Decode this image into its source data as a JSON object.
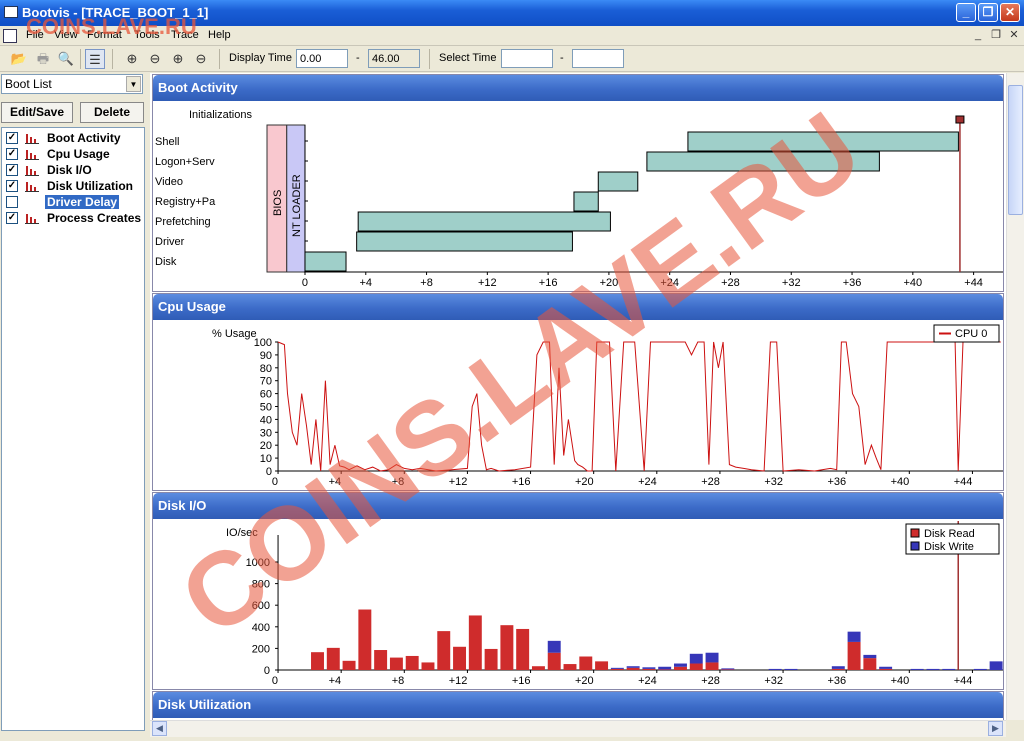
{
  "window": {
    "title": "Bootvis - [TRACE_BOOT_1_1]",
    "minimize": "_",
    "maximize": "❐",
    "close": "✕"
  },
  "menu": {
    "items": [
      "File",
      "View",
      "Format",
      "Tools",
      "Trace",
      "Help"
    ],
    "mdi_min": "_",
    "mdi_restore": "❐",
    "mdi_close": "✕"
  },
  "toolbar": {
    "display_time_label": "Display Time",
    "display_time_from": "0.00",
    "display_time_sep": "-",
    "display_time_to": "46.00",
    "select_time_label": "Select Time",
    "select_time_from": "",
    "select_time_sep": "-",
    "select_time_to": ""
  },
  "left": {
    "combo_value": "Boot List",
    "edit_save": "Edit/Save",
    "delete": "Delete",
    "items": [
      {
        "label": "Boot Activity",
        "checked": true,
        "selected": false
      },
      {
        "label": "Cpu Usage",
        "checked": true,
        "selected": false
      },
      {
        "label": "Disk I/O",
        "checked": true,
        "selected": false
      },
      {
        "label": "Disk Utilization",
        "checked": true,
        "selected": false
      },
      {
        "label": "Driver Delay",
        "checked": false,
        "selected": true
      },
      {
        "label": "Process Creates",
        "checked": true,
        "selected": false
      }
    ]
  },
  "check_mark": "✓",
  "panels": {
    "boot_activity": "Boot Activity",
    "cpu_usage": "Cpu Usage",
    "disk_io": "Disk I/O",
    "disk_utilization": "Disk Utilization"
  },
  "watermark": {
    "small": "COINS.LAVE.RU",
    "big": "COINS.LAVE.RU",
    "color": "#e8553a"
  },
  "colors": {
    "bar_fill": "#9fcfc9",
    "bios": "#f9c8cf",
    "ntloader": "#c9c8f6",
    "cpu_line": "#cc1111",
    "disk_read": "#cf2c2c",
    "disk_write": "#3636b8",
    "marker": "#a03030"
  },
  "chart_data": [
    {
      "type": "bar",
      "name_ref": "boot_activity",
      "top_label": "Initializations",
      "rows": [
        "Shell",
        "Logon+Serv",
        "Video",
        "Registry+Pa",
        "Prefetching",
        "Driver",
        "Disk"
      ],
      "phase_labels": [
        "BIOS",
        "NT LOADER"
      ],
      "x_ticks": [
        "0",
        "+4",
        "+8",
        "+12",
        "+16",
        "+20",
        "+24",
        "+28",
        "+32",
        "+36",
        "+40",
        "+44"
      ],
      "xlim": [
        -2.5,
        46.0
      ],
      "phases": [
        {
          "label": "BIOS",
          "start": -2.5,
          "end": -1.2
        },
        {
          "label": "NT LOADER",
          "start": -1.2,
          "end": 0.0
        }
      ],
      "segments": [
        {
          "row": "Shell",
          "start": 25.2,
          "end": 43.0
        },
        {
          "row": "Logon+Serv",
          "start": 22.5,
          "end": 37.8
        },
        {
          "row": "Video",
          "start": 19.3,
          "end": 21.9
        },
        {
          "row": "Registry+Pa",
          "start": 17.7,
          "end": 19.3
        },
        {
          "row": "Prefetching",
          "start": 3.5,
          "end": 20.1
        },
        {
          "row": "Driver",
          "start": 3.4,
          "end": 17.6
        },
        {
          "row": "Disk",
          "start": 0.0,
          "end": 2.7
        }
      ],
      "marker_time": 43.1
    },
    {
      "type": "line",
      "name_ref": "cpu_usage",
      "ylabel": "% Usage",
      "ylim": [
        0,
        100
      ],
      "y_ticks": [
        "0",
        "10",
        "20",
        "30",
        "40",
        "50",
        "60",
        "70",
        "80",
        "90",
        "100"
      ],
      "x_ticks": [
        "0",
        "+4",
        "+8",
        "+12",
        "+16",
        "+20",
        "+24",
        "+28",
        "+32",
        "+36",
        "+40",
        "+44"
      ],
      "xlim": [
        -0.7,
        46.0
      ],
      "series": [
        {
          "name": "CPU 0",
          "color": "#cc1111",
          "x": [
            0.0,
            0.4,
            0.6,
            0.9,
            1.2,
            1.5,
            1.8,
            2.1,
            2.4,
            2.7,
            3.0,
            3.3,
            3.6,
            3.9,
            4.2,
            4.5,
            5.0,
            5.5,
            6.0,
            6.5,
            7.0,
            7.5,
            8.0,
            8.5,
            9.0,
            10.0,
            11.0,
            12.0,
            12.3,
            12.6,
            12.9,
            13.2,
            13.5,
            14.0,
            15.0,
            16.0,
            16.4,
            16.8,
            17.2,
            17.5,
            17.8,
            18.1,
            18.4,
            18.8,
            19.0,
            19.3,
            19.6,
            19.9,
            20.2,
            20.6,
            21.0,
            21.4,
            21.9,
            22.2,
            22.6,
            23.2,
            23.6,
            24.0,
            24.5,
            25.0,
            25.4,
            25.8,
            26.2,
            26.6,
            27.0,
            27.3,
            27.6,
            27.9,
            28.2,
            28.6,
            29.0,
            29.5,
            30.0,
            30.8,
            31.2,
            31.6,
            32.0,
            33.0,
            34.0,
            35.0,
            35.4,
            35.7,
            36.0,
            36.4,
            36.8,
            37.2,
            37.6,
            37.9,
            38.2,
            38.6,
            39.0,
            40.0,
            41.0,
            42.0,
            42.6,
            42.9,
            43.1,
            43.4,
            44.0,
            45.0,
            45.8
          ],
          "values": [
            100,
            98,
            60,
            30,
            20,
            60,
            35,
            5,
            40,
            0,
            70,
            5,
            20,
            4,
            3,
            1,
            4,
            1,
            3,
            0,
            1,
            5,
            2,
            1,
            2,
            0,
            1,
            2,
            50,
            60,
            20,
            1,
            2,
            0,
            1,
            3,
            90,
            100,
            100,
            5,
            80,
            12,
            40,
            8,
            5,
            3,
            0,
            0,
            100,
            100,
            100,
            0,
            100,
            100,
            100,
            0,
            100,
            100,
            100,
            100,
            100,
            100,
            90,
            100,
            100,
            5,
            100,
            80,
            100,
            5,
            3,
            2,
            1,
            0,
            100,
            100,
            0,
            1,
            0,
            2,
            1,
            100,
            100,
            60,
            50,
            5,
            20,
            10,
            1,
            100,
            100,
            100,
            100,
            100,
            100,
            100,
            0,
            100,
            100,
            100,
            100
          ]
        }
      ],
      "legend": "top-right"
    },
    {
      "type": "bar",
      "name_ref": "disk_io",
      "ylabel": "IO/sec",
      "y_ticks": [
        "0",
        "200",
        "400",
        "600",
        "800",
        "1000"
      ],
      "ylim": [
        0,
        1250
      ],
      "x_ticks": [
        "0",
        "+4",
        "+8",
        "+12",
        "+16",
        "+20",
        "+24",
        "+28",
        "+32",
        "+36",
        "+40",
        "+44"
      ],
      "xlim": [
        -0.7,
        46.0
      ],
      "stacked": true,
      "x": [
        2.5,
        3.5,
        4.5,
        5.5,
        6.5,
        7.5,
        8.5,
        9.5,
        10.5,
        11.5,
        12.5,
        13.5,
        14.5,
        15.5,
        16.5,
        17.5,
        18.5,
        19.5,
        20.5,
        21.5,
        22.5,
        23.5,
        24.5,
        25.5,
        26.5,
        27.5,
        28.5,
        31.5,
        32.5,
        35.5,
        36.5,
        37.5,
        38.5,
        40.5,
        41.5,
        42.5,
        44.5,
        45.5
      ],
      "series": [
        {
          "name": "Disk Read",
          "color": "#cf2c2c",
          "values": [
            165,
            205,
            85,
            560,
            185,
            115,
            130,
            70,
            360,
            215,
            505,
            195,
            415,
            380,
            35,
            160,
            55,
            125,
            80,
            10,
            20,
            10,
            5,
            30,
            60,
            70,
            5,
            0,
            0,
            10,
            260,
            110,
            10,
            0,
            0,
            0,
            0,
            0
          ]
        },
        {
          "name": "Disk Write",
          "color": "#3636b8",
          "values": [
            0,
            0,
            0,
            0,
            0,
            0,
            0,
            0,
            0,
            0,
            0,
            0,
            0,
            0,
            0,
            110,
            0,
            0,
            0,
            10,
            15,
            15,
            25,
            30,
            90,
            90,
            10,
            10,
            10,
            25,
            95,
            30,
            20,
            10,
            10,
            10,
            10,
            80
          ]
        }
      ],
      "marker_time": 43.1,
      "legend": "top-right"
    }
  ]
}
